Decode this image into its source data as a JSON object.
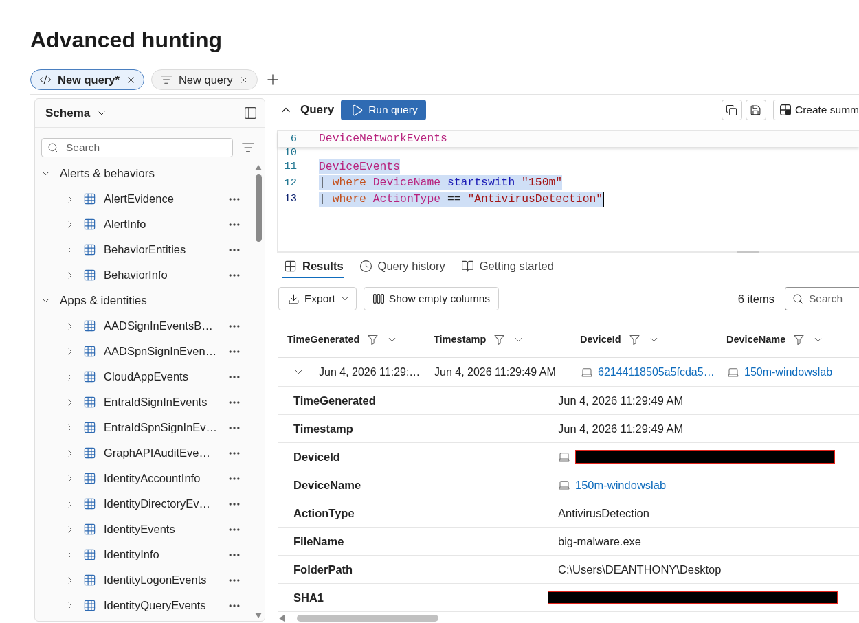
{
  "page": {
    "title": "Advanced hunting"
  },
  "query_tabs": [
    {
      "label": "New query*",
      "selected": true
    },
    {
      "label": "New query",
      "selected": false
    }
  ],
  "schema": {
    "title": "Schema",
    "search": {
      "placeholder": "Search"
    },
    "groups": [
      {
        "label": "Alerts & behaviors",
        "expanded": true,
        "children": [
          {
            "label": "AlertEvidence",
            "expanded": false
          },
          {
            "label": "AlertInfo",
            "expanded": false
          },
          {
            "label": "BehaviorEntities",
            "expanded": false
          },
          {
            "label": "BehaviorInfo",
            "expanded": false
          }
        ]
      },
      {
        "label": "Apps & identities",
        "expanded": true,
        "children": [
          {
            "label": "AADSignInEventsB…",
            "expanded": false
          },
          {
            "label": "AADSpnSignInEven…",
            "expanded": false
          },
          {
            "label": "CloudAppEvents",
            "expanded": false
          },
          {
            "label": "EntraIdSignInEvents",
            "expanded": false
          },
          {
            "label": "EntraIdSpnSignInEv…",
            "expanded": false
          },
          {
            "label": "GraphAPIAuditEve…",
            "expanded": false
          },
          {
            "label": "IdentityAccountInfo",
            "expanded": false
          },
          {
            "label": "IdentityDirectoryEv…",
            "expanded": false
          },
          {
            "label": "IdentityEvents",
            "expanded": false
          },
          {
            "label": "IdentityInfo",
            "expanded": false
          },
          {
            "label": "IdentityLogonEvents",
            "expanded": false
          },
          {
            "label": "IdentityQueryEvents",
            "expanded": false
          }
        ]
      }
    ]
  },
  "query": {
    "title": "Query",
    "run_label": "Run query",
    "create_label": "Create summ",
    "lines": [
      {
        "number": "6",
        "kind": "sticky",
        "selected": false,
        "current": false,
        "tokens": [
          {
            "text": "DeviceNetworkEvents",
            "kind": "table"
          }
        ]
      },
      {
        "number": "10",
        "kind": "partial",
        "current": false
      },
      {
        "number": "11",
        "kind": "normal",
        "selected": true,
        "current": false,
        "tokens": [
          {
            "text": "DeviceEvents",
            "kind": "table"
          }
        ]
      },
      {
        "number": "12",
        "kind": "normal",
        "selected": true,
        "current": false,
        "tokens": [
          {
            "text": "| ",
            "kind": "plain"
          },
          {
            "text": "where",
            "kind": "keyword"
          },
          {
            "text": " DeviceName",
            "kind": "column"
          },
          {
            "text": " startswith",
            "kind": "operator"
          },
          {
            "text": " \"150m\"",
            "kind": "string"
          }
        ]
      },
      {
        "number": "13",
        "kind": "normal",
        "selected": true,
        "current": true,
        "tokens": [
          {
            "text": "| ",
            "kind": "plain"
          },
          {
            "text": "where",
            "kind": "keyword"
          },
          {
            "text": " ActionType",
            "kind": "column"
          },
          {
            "text": " == ",
            "kind": "plain"
          },
          {
            "text": "\"AntivirusDetection\"",
            "kind": "string"
          }
        ]
      }
    ]
  },
  "results": {
    "tabs": [
      {
        "label": "Results",
        "selected": true
      },
      {
        "label": "Query history",
        "selected": false
      },
      {
        "label": "Getting started",
        "selected": false
      }
    ],
    "export_label": "Export",
    "empty_columns_label": "Show empty columns",
    "item_count": "6 items",
    "search": {
      "placeholder": "Search"
    },
    "table": {
      "columns": [
        "TimeGenerated",
        "Timestamp",
        "DeviceId",
        "DeviceName"
      ],
      "rows": [
        {
          "expanded": true,
          "cells": [
            {
              "kind": "text",
              "text": "Jun 4, 2026 11:29:…"
            },
            {
              "kind": "text",
              "text": "Jun 4, 2026 11:29:49 AM"
            },
            {
              "kind": "device",
              "text": "62144118505a5fcda5…"
            },
            {
              "kind": "device",
              "text": "150m-windowslab"
            }
          ],
          "details": [
            {
              "label": "TimeGenerated",
              "kind": "text",
              "value": "Jun 4, 2026 11:29:49 AM"
            },
            {
              "label": "Timestamp",
              "kind": "text",
              "value": "Jun 4, 2026 11:29:49 AM"
            },
            {
              "label": "DeviceId",
              "kind": "redacted-device"
            },
            {
              "label": "DeviceName",
              "kind": "device",
              "value": "150m-windowslab"
            },
            {
              "label": "ActionType",
              "kind": "text",
              "value": "AntivirusDetection"
            },
            {
              "label": "FileName",
              "kind": "text",
              "value": "big-malware.exe"
            },
            {
              "label": "FolderPath",
              "kind": "text",
              "value": "C:\\Users\\DEANTHONY\\Desktop"
            },
            {
              "label": "SHA1",
              "kind": "redacted"
            }
          ]
        }
      ]
    }
  }
}
